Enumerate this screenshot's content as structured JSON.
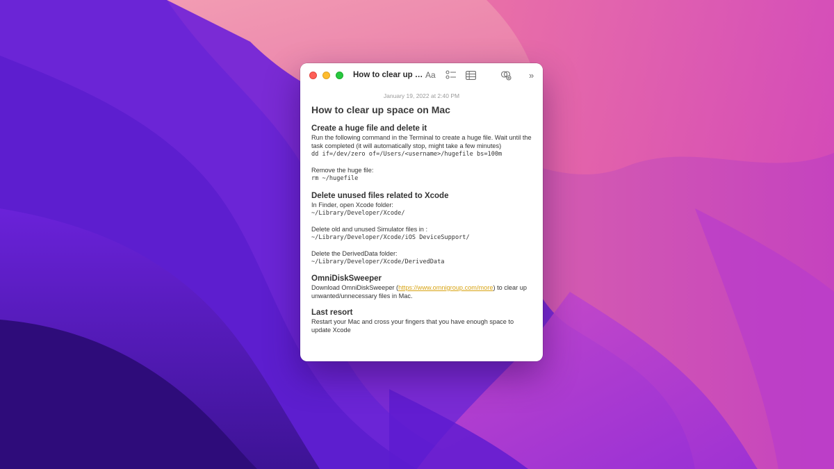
{
  "window": {
    "title": "How to clear up sp...",
    "toolbar": {
      "format_label": "Aa",
      "checklist_icon": "checklist-icon",
      "table_icon": "table-icon",
      "collaborate_icon": "collaborate-icon",
      "more_label": "»"
    }
  },
  "note": {
    "date": "January 19, 2022 at 2:40 PM",
    "title": "How to clear up space on Mac",
    "sections": [
      {
        "heading": "Create a huge file and delete it",
        "text": "Run the following command in the Terminal to create a huge file. Wait until the task completed (it will automatically stop, might take a few minutes)",
        "code": "dd if=/dev/zero of=/Users/<username>/hugefile bs=100m",
        "text2": "Remove the huge file:",
        "code2": "rm ~/hugefile"
      },
      {
        "heading": "Delete unused files related to Xcode",
        "text": "In Finder, open Xcode folder:",
        "code": "~/Library/Developer/Xcode/",
        "text2": "Delete old and unused Simulator files in :",
        "code2": "~/Library/Developer/Xcode/iOS DeviceSupport/",
        "text3": "Delete the DerivedData folder:",
        "code3": "~/Library/Developer/Xcode/DerivedData"
      },
      {
        "heading": "OmniDiskSweeper",
        "text_before": "Download OmniDiskSweeper (",
        "link": "https://www.omnigroup.com/more",
        "text_after": ") to clear up unwanted/unnecessary files in Mac."
      },
      {
        "heading": "Last resort",
        "text": "Restart your Mac and cross your fingers that you have enough space to update Xcode"
      }
    ]
  },
  "colors": {
    "link": "#d8a312",
    "close": "#fe5f57",
    "minimize": "#febc2e",
    "zoom": "#28c840"
  }
}
